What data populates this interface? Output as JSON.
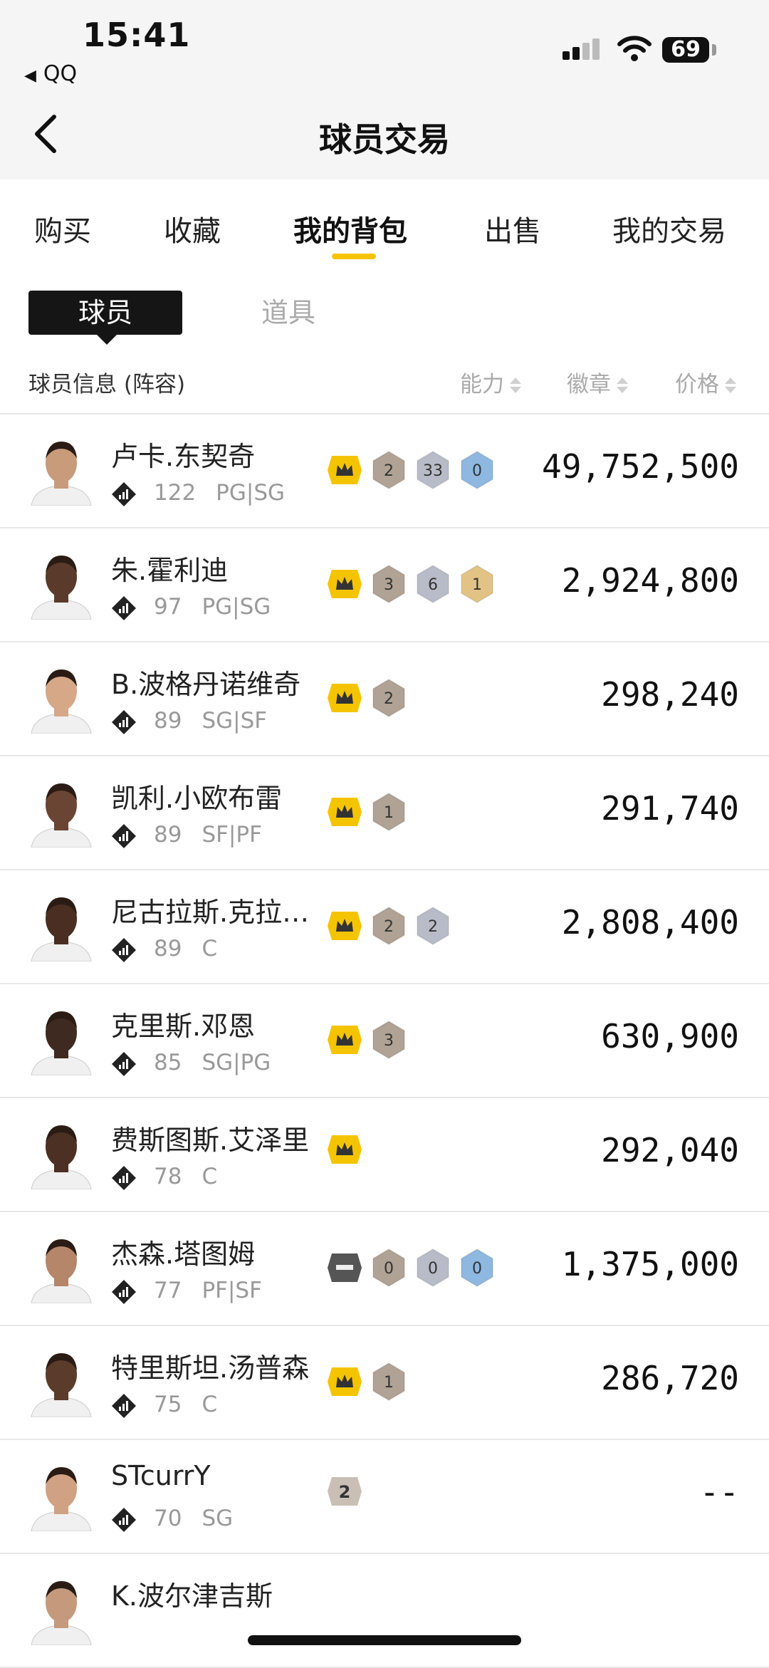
{
  "status": {
    "time": "15:41",
    "back_app": "QQ",
    "battery": "69"
  },
  "nav": {
    "title": "球员交易"
  },
  "tabs": [
    {
      "label": "购买",
      "active": false
    },
    {
      "label": "收藏",
      "active": false
    },
    {
      "label": "我的背包",
      "active": true
    },
    {
      "label": "出售",
      "active": false
    },
    {
      "label": "我的交易",
      "active": false
    }
  ],
  "segments": {
    "active": "球员",
    "inactive": "道具"
  },
  "columns": {
    "info": "球员信息 (阵容)",
    "ability": "能力",
    "badge": "徽章",
    "price": "价格"
  },
  "colors": {
    "accent": "#f5c400",
    "bronze": "#b0a294",
    "silver": "#b8bcc8",
    "gold": "#e2c386",
    "blue": "#8fb8e0"
  },
  "players": [
    {
      "name": "卢卡.东契奇",
      "rating": "122",
      "position": "PG|SG",
      "price": "49,752,500",
      "badges": [
        {
          "type": "crown"
        },
        {
          "type": "bronze",
          "value": "2"
        },
        {
          "type": "silver",
          "value": "33"
        },
        {
          "type": "blue",
          "value": "0"
        }
      ]
    },
    {
      "name": "朱.霍利迪",
      "rating": "97",
      "position": "PG|SG",
      "price": "2,924,800",
      "badges": [
        {
          "type": "crown"
        },
        {
          "type": "bronze",
          "value": "3"
        },
        {
          "type": "silver",
          "value": "6"
        },
        {
          "type": "gold",
          "value": "1"
        }
      ]
    },
    {
      "name": "B.波格丹诺维奇",
      "rating": "89",
      "position": "SG|SF",
      "price": "298,240",
      "badges": [
        {
          "type": "crown"
        },
        {
          "type": "bronze",
          "value": "2"
        }
      ]
    },
    {
      "name": "凯利.小欧布雷",
      "rating": "89",
      "position": "SF|PF",
      "price": "291,740",
      "badges": [
        {
          "type": "crown"
        },
        {
          "type": "bronze",
          "value": "1"
        }
      ]
    },
    {
      "name": "尼古拉斯.克拉克斯顿",
      "rating": "89",
      "position": "C",
      "price": "2,808,400",
      "badges": [
        {
          "type": "crown"
        },
        {
          "type": "bronze",
          "value": "2"
        },
        {
          "type": "silver",
          "value": "2"
        }
      ]
    },
    {
      "name": "克里斯.邓恩",
      "rating": "85",
      "position": "SG|PG",
      "price": "630,900",
      "badges": [
        {
          "type": "crown"
        },
        {
          "type": "bronze",
          "value": "3"
        }
      ]
    },
    {
      "name": "费斯图斯.艾泽里",
      "rating": "78",
      "position": "C",
      "price": "292,040",
      "badges": [
        {
          "type": "crown"
        }
      ]
    },
    {
      "name": "杰森.塔图姆",
      "rating": "77",
      "position": "PF|SF",
      "price": "1,375,000",
      "badges": [
        {
          "type": "dash"
        },
        {
          "type": "bronze",
          "value": "0"
        },
        {
          "type": "silver",
          "value": "0"
        },
        {
          "type": "blue",
          "value": "0"
        }
      ]
    },
    {
      "name": "特里斯坦.汤普森",
      "rating": "75",
      "position": "C",
      "price": "286,720",
      "badges": [
        {
          "type": "crown"
        },
        {
          "type": "bronze",
          "value": "1"
        }
      ]
    },
    {
      "name": "STcurrY",
      "rating": "70",
      "position": "SG",
      "price": "--",
      "badges": [
        {
          "type": "plain",
          "value": "2"
        }
      ]
    },
    {
      "name": "K.波尔津吉斯",
      "rating": "",
      "position": "",
      "price": "",
      "badges": []
    }
  ]
}
